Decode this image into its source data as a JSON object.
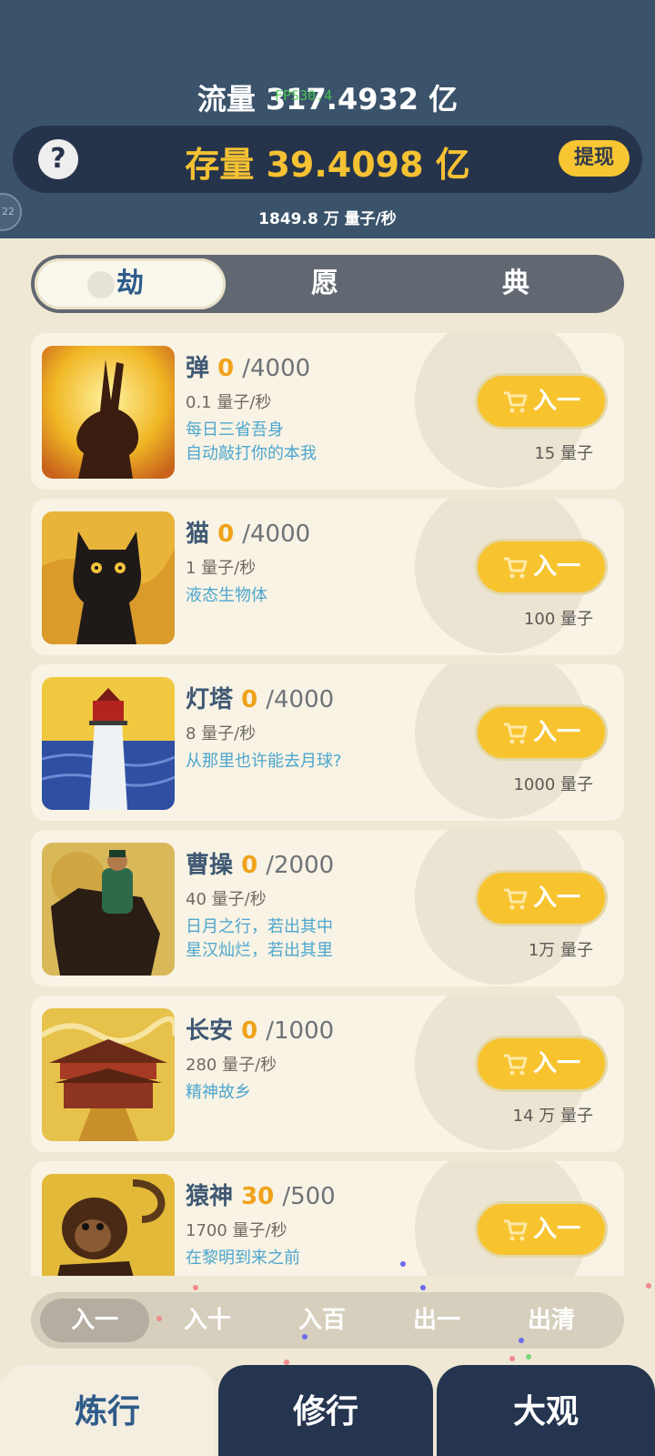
{
  "header": {
    "flow_label": "流量 317.4932 亿",
    "fps_overlay": "FPS30.4",
    "stock_label": "存量 39.4098 亿",
    "help_icon": "question-icon",
    "withdraw_label": "提现",
    "side_badge": "22",
    "rate_label": "1849.8 万  量子/秒"
  },
  "tabs": [
    {
      "label": "劫",
      "active": true
    },
    {
      "label": "愿",
      "active": false
    },
    {
      "label": "典",
      "active": false
    }
  ],
  "items": [
    {
      "name": "弹",
      "count": "0",
      "max": "/4000",
      "rate": "0.1 量子/秒",
      "desc": [
        "每日三省吾身",
        "自动敲打你的本我"
      ],
      "button": "入一",
      "cost": "15 量子",
      "image": "rabbit-shadow-painting"
    },
    {
      "name": "猫",
      "count": "0",
      "max": "/4000",
      "rate": "1 量子/秒",
      "desc": [
        "液态生物体"
      ],
      "button": "入一",
      "cost": "100 量子",
      "image": "black-cat-painting"
    },
    {
      "name": "灯塔",
      "count": "0",
      "max": "/4000",
      "rate": "8 量子/秒",
      "desc": [
        "从那里也许能去月球?"
      ],
      "button": "入一",
      "cost": "1000 量子",
      "image": "lighthouse-painting"
    },
    {
      "name": "曹操",
      "count": "0",
      "max": "/2000",
      "rate": "40 量子/秒",
      "desc": [
        "日月之行，若出其中",
        "星汉灿烂，若出其里"
      ],
      "button": "入一",
      "cost": "1万 量子",
      "image": "rider-on-horse-painting"
    },
    {
      "name": "长安",
      "count": "0",
      "max": "/1000",
      "rate": "280 量子/秒",
      "desc": [
        "精神故乡"
      ],
      "button": "入一",
      "cost": "14 万 量子",
      "image": "palace-painting"
    },
    {
      "name": "猿神",
      "count": "30",
      "max": "/500",
      "rate": "1700 量子/秒",
      "desc": [
        "在黎明到来之前"
      ],
      "button": "入一",
      "cost": "",
      "image": "monkey-painting"
    }
  ],
  "quantity": [
    {
      "label": "入一",
      "active": true
    },
    {
      "label": "入十",
      "active": false
    },
    {
      "label": "入百",
      "active": false
    },
    {
      "label": "出一",
      "active": false
    },
    {
      "label": "出清",
      "active": false
    }
  ],
  "nav": [
    {
      "label": "炼行",
      "active": true
    },
    {
      "label": "修行",
      "active": false
    },
    {
      "label": "大观",
      "active": false
    }
  ],
  "colors": {
    "header_bg": "#3a536b",
    "stock_bar": "#26344b",
    "gold": "#f5c233",
    "accent_blue": "#2f5b8a",
    "desc_blue": "#4da6cf",
    "count_orange": "#f0a21b",
    "page_bg": "#efe8d5"
  }
}
